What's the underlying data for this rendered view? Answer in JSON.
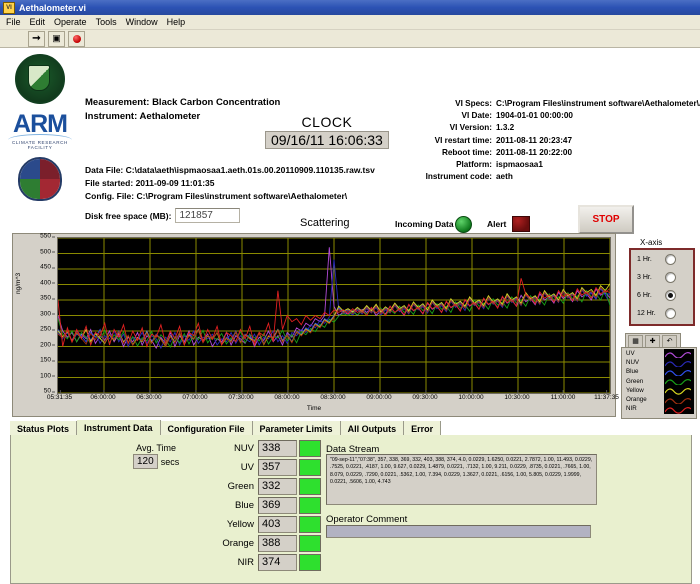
{
  "window": {
    "title": "Aethalometer.vi",
    "icon": "labview-icon"
  },
  "menu": [
    "File",
    "Edit",
    "Operate",
    "Tools",
    "Window",
    "Help"
  ],
  "toolbar": {
    "run_icon": "run-arrow-icon",
    "pause_icon": "pause-icon",
    "abort_icon": "abort-record-icon"
  },
  "logos": {
    "doe_seal": "doe-seal",
    "arm_word": "ARM",
    "arm_sub": "CLIMATE RESEARCH FACILITY",
    "shield": "arm-shield"
  },
  "header": {
    "measurement_label": "Measurement:",
    "measurement_value": "Black Carbon Concentration",
    "instrument_label": "Instrument:",
    "instrument_value": "Aethalometer",
    "clock_title": "CLOCK",
    "clock_value": "09/16/11 16:06:33",
    "data_file_label": "Data File:",
    "data_file_value": "C:\\data\\aeth\\ispmaosaa1.aeth.01s.00.20110909.110135.raw.tsv",
    "file_started_label": "File started:",
    "file_started_value": "2011-09-09 11:01:35",
    "config_file_label": "Config. File:",
    "config_file_value": "C:\\Program Files\\instrument software\\Aethalometer\\",
    "disk_label": "Disk free space (MB):",
    "disk_value": "121857"
  },
  "vi_specs": [
    {
      "key": "VI Specs:",
      "value": "C:\\Program Files\\instrument software\\Aethalometer\\Aethalometer"
    },
    {
      "key": "VI Date:",
      "value": "1904-01-01 00:00:00"
    },
    {
      "key": "VI Version:",
      "value": "1.3.2"
    },
    {
      "key": "VI restart time:",
      "value": "2011-08-11 20:23:47"
    },
    {
      "key": "Reboot time:",
      "value": "2011-08-11 20:22:00"
    },
    {
      "key": "Platform:",
      "value": "ispmaosaa1"
    },
    {
      "key": "Instrument code:",
      "value": "aeth"
    }
  ],
  "indicators": {
    "scattering_label": "Scattering",
    "incoming_data_label": "Incoming Data",
    "incoming_data_state": "on",
    "alert_label": "Alert",
    "alert_state": "off",
    "stop_label": "STOP"
  },
  "x_axis_selector": {
    "title": "X-axis",
    "options": [
      "1 Hr.",
      "3 Hr.",
      "6 Hr.",
      "12 Hr."
    ],
    "selected": "6 Hr."
  },
  "legend": {
    "tools": [
      "grid-icon",
      "cursor-icon",
      "undo-icon"
    ],
    "entries": [
      {
        "name": "UV",
        "color": "#b24bd8"
      },
      {
        "name": "NUV",
        "color": "#2a2ab8"
      },
      {
        "name": "Blue",
        "color": "#3050f0"
      },
      {
        "name": "Green",
        "color": "#18a018"
      },
      {
        "name": "Yellow",
        "color": "#d8d820"
      },
      {
        "name": "Orange",
        "color": "#a03010"
      },
      {
        "name": "NIR",
        "color": "#e02020"
      }
    ]
  },
  "chart_data": {
    "type": "line",
    "title": "Scattering",
    "xlabel": "Time",
    "ylabel": "ng/m^3",
    "ylim": [
      50,
      550
    ],
    "yticks": [
      50,
      100,
      150,
      200,
      250,
      300,
      350,
      400,
      450,
      500,
      550
    ],
    "xticks": [
      "05:31:35",
      "06:00:00",
      "06:30:00",
      "07:00:00",
      "07:30:00",
      "08:00:00",
      "08:30:00",
      "09:00:00",
      "09:30:00",
      "10:00:00",
      "10:30:00",
      "11:00:00",
      "11:37:35"
    ],
    "grid": true,
    "grid_color": "#8a8a00",
    "plot_bg": "#000000",
    "series": [
      {
        "name": "UV",
        "color": "#b24bd8",
        "values": [
          300,
          250,
          230,
          245,
          215,
          240,
          225,
          255,
          210,
          235,
          220,
          250,
          215,
          240,
          200,
          230,
          215,
          245,
          205,
          235,
          220,
          195,
          230,
          210,
          245,
          200,
          235,
          215,
          250,
          205,
          230,
          220,
          240,
          200,
          225,
          215,
          245,
          205,
          235,
          225,
          210,
          240,
          200,
          230,
          220,
          250,
          215,
          235,
          205,
          245,
          230,
          260,
          250,
          275,
          265,
          290,
          280,
          300,
          520,
          330,
          300,
          310,
          305,
          315,
          300,
          320,
          310,
          325,
          300,
          315,
          305,
          330,
          310,
          320,
          300,
          335,
          315,
          325,
          305,
          340,
          320,
          330,
          310,
          345,
          325,
          335,
          315,
          350,
          330,
          340,
          320,
          355,
          335,
          345,
          325,
          360,
          340,
          350,
          330,
          365,
          345,
          355,
          335,
          370,
          350,
          360,
          340,
          375,
          355,
          365,
          345,
          380,
          360,
          370,
          350,
          385,
          365,
          375,
          357
        ]
      },
      {
        "name": "NUV",
        "color": "#2a2ab8",
        "values": [
          245,
          225,
          250,
          215,
          240,
          230,
          255,
          220,
          245,
          210,
          235,
          225,
          250,
          215,
          240,
          200,
          230,
          220,
          245,
          210,
          235,
          225,
          195,
          230,
          215,
          245,
          205,
          235,
          220,
          250,
          210,
          230,
          225,
          240,
          205,
          225,
          215,
          245,
          210,
          235,
          225,
          215,
          240,
          205,
          230,
          225,
          250,
          215,
          235,
          210,
          245,
          235,
          255,
          245,
          270,
          260,
          285,
          275,
          295,
          480,
          320,
          305,
          312,
          302,
          318,
          305,
          322,
          308,
          326,
          302,
          318,
          308,
          332,
          312,
          322,
          305,
          336,
          318,
          328,
          308,
          342,
          322,
          332,
          312,
          346,
          326,
          336,
          316,
          352,
          332,
          342,
          322,
          356,
          336,
          346,
          326,
          362,
          342,
          352,
          332,
          366,
          346,
          356,
          336,
          372,
          352,
          362,
          342,
          376,
          356,
          366,
          346,
          382,
          362,
          372,
          352,
          386,
          366,
          338
        ]
      },
      {
        "name": "Blue",
        "color": "#3050f0",
        "values": [
          255,
          230,
          245,
          220,
          250,
          235,
          215,
          245,
          230,
          255,
          210,
          240,
          225,
          250,
          215,
          235,
          205,
          230,
          220,
          250,
          215,
          240,
          225,
          200,
          235,
          215,
          245,
          210,
          240,
          225,
          255,
          215,
          235,
          225,
          245,
          210,
          230,
          220,
          250,
          215,
          240,
          230,
          220,
          245,
          210,
          235,
          230,
          255,
          220,
          240,
          215,
          250,
          240,
          260,
          250,
          275,
          265,
          290,
          280,
          300,
          325,
          310,
          318,
          308,
          322,
          310,
          328,
          312,
          332,
          308,
          324,
          312,
          336,
          318,
          328,
          310,
          340,
          322,
          334,
          314,
          346,
          328,
          338,
          318,
          350,
          332,
          342,
          326,
          356,
          336,
          346,
          328,
          360,
          340,
          350,
          332,
          366,
          346,
          356,
          336,
          370,
          350,
          360,
          340,
          376,
          356,
          366,
          346,
          380,
          360,
          370,
          350,
          386,
          366,
          376,
          356,
          390,
          370,
          369
        ]
      },
      {
        "name": "Green",
        "color": "#18a018",
        "values": [
          290,
          240,
          225,
          250,
          215,
          245,
          230,
          210,
          240,
          225,
          252,
          212,
          238,
          222,
          248,
          212,
          232,
          202,
          228,
          218,
          248,
          212,
          238,
          222,
          198,
          232,
          212,
          242,
          208,
          238,
          222,
          252,
          212,
          232,
          222,
          242,
          208,
          228,
          218,
          248,
          212,
          238,
          228,
          218,
          242,
          208,
          232,
          228,
          252,
          218,
          238,
          212,
          248,
          238,
          258,
          248,
          272,
          262,
          288,
          278,
          298,
          306,
          300,
          312,
          302,
          316,
          305,
          320,
          308,
          324,
          302,
          318,
          306,
          330,
          310,
          320,
          304,
          334,
          316,
          326,
          306,
          338,
          320,
          330,
          310,
          344,
          324,
          334,
          314,
          350,
          330,
          340,
          320,
          354,
          334,
          344,
          324,
          360,
          340,
          350,
          330,
          364,
          344,
          354,
          334,
          370,
          350,
          360,
          340,
          374,
          354,
          364,
          344,
          380,
          360,
          370,
          350,
          384,
          332
        ]
      },
      {
        "name": "Yellow",
        "color": "#d8d820",
        "values": [
          250,
          232,
          248,
          218,
          244,
          228,
          254,
          216,
          242,
          226,
          210,
          238,
          220,
          246,
          214,
          234,
          206,
          228,
          216,
          246,
          212,
          236,
          224,
          202,
          234,
          214,
          244,
          206,
          236,
          224,
          254,
          214,
          234,
          224,
          244,
          206,
          226,
          216,
          246,
          214,
          236,
          226,
          216,
          244,
          206,
          234,
          226,
          254,
          216,
          236,
          214,
          246,
          236,
          256,
          246,
          272,
          262,
          286,
          276,
          296,
          330,
          314,
          322,
          312,
          326,
          314,
          332,
          316,
          336,
          312,
          328,
          316,
          340,
          322,
          332,
          314,
          344,
          326,
          338,
          318,
          350,
          332,
          342,
          322,
          354,
          336,
          346,
          330,
          360,
          340,
          350,
          332,
          364,
          344,
          354,
          336,
          370,
          350,
          360,
          340,
          374,
          354,
          364,
          344,
          380,
          360,
          370,
          350,
          384,
          364,
          374,
          354,
          390,
          374,
          384,
          364,
          396,
          380,
          403
        ]
      },
      {
        "name": "Orange",
        "color": "#a03010",
        "values": [
          240,
          228,
          252,
          214,
          246,
          226,
          208,
          242,
          222,
          250,
          212,
          240,
          222,
          248,
          210,
          236,
          204,
          226,
          218,
          244,
          210,
          238,
          222,
          200,
          232,
          212,
          246,
          208,
          234,
          226,
          252,
          212,
          236,
          222,
          246,
          208,
          228,
          214,
          248,
          212,
          238,
          224,
          214,
          246,
          208,
          236,
          224,
          252,
          214,
          238,
          212,
          248,
          234,
          254,
          244,
          270,
          260,
          284,
          274,
          294,
          320,
          308,
          316,
          306,
          320,
          308,
          326,
          310,
          330,
          306,
          322,
          310,
          334,
          316,
          326,
          308,
          338,
          320,
          332,
          312,
          344,
          326,
          336,
          316,
          348,
          330,
          340,
          324,
          354,
          334,
          344,
          326,
          358,
          338,
          348,
          330,
          364,
          344,
          354,
          334,
          368,
          348,
          358,
          338,
          374,
          354,
          364,
          344,
          378,
          358,
          368,
          348,
          384,
          368,
          378,
          358,
          390,
          374,
          388
        ]
      },
      {
        "name": "NIR",
        "color": "#e02020",
        "values": [
          350,
          200,
          260,
          215,
          255,
          225,
          265,
          205,
          245,
          235,
          275,
          205,
          255,
          230,
          270,
          210,
          250,
          220,
          260,
          200,
          240,
          230,
          270,
          210,
          250,
          225,
          265,
          205,
          245,
          235,
          275,
          215,
          255,
          225,
          265,
          205,
          245,
          235,
          215,
          255,
          225,
          265,
          205,
          245,
          235,
          275,
          215,
          380,
          255,
          300,
          280,
          290,
          270,
          300,
          285,
          300,
          290,
          310,
          300,
          318,
          310,
          318,
          306,
          322,
          310,
          316,
          300,
          326,
          308,
          320,
          300,
          330,
          310,
          322,
          302,
          336,
          316,
          326,
          306,
          342,
          322,
          332,
          310,
          346,
          326,
          336,
          314,
          352,
          332,
          342,
          320,
          356,
          336,
          346,
          324,
          362,
          342,
          352,
          330,
          420,
          368,
          358,
          338,
          376,
          356,
          366,
          344,
          380,
          360,
          370,
          348,
          386,
          366,
          376,
          356,
          390,
          370,
          380,
          374
        ]
      }
    ]
  },
  "tabs": [
    {
      "label": "Status Plots",
      "active": false
    },
    {
      "label": "Instrument Data",
      "active": true
    },
    {
      "label": "Configuration File",
      "active": false
    },
    {
      "label": "Parameter Limits",
      "active": false
    },
    {
      "label": "All Outputs",
      "active": false
    },
    {
      "label": "Error",
      "active": false
    }
  ],
  "instrument_data": {
    "avg_time_label": "Avg. Time",
    "avg_time_value": "120",
    "avg_time_unit": "secs",
    "readouts": [
      {
        "label": "NUV",
        "value": "338",
        "led": "#2ee02e"
      },
      {
        "label": "UV",
        "value": "357",
        "led": "#2ee02e"
      },
      {
        "label": "Green",
        "value": "332",
        "led": "#2ee02e"
      },
      {
        "label": "Blue",
        "value": "369",
        "led": "#2ee02e"
      },
      {
        "label": "Yellow",
        "value": "403",
        "led": "#2ee02e"
      },
      {
        "label": "Orange",
        "value": "388",
        "led": "#2ee02e"
      },
      {
        "label": "NIR",
        "value": "374",
        "led": "#2ee02e"
      }
    ],
    "data_stream_label": "Data Stream",
    "data_stream_value": "\"09-sep-11\",\"07:38\",  357,  338,  369,  332,  403,  388,  374, 4.0, 0.0229, 1.6250, 0.0221, 2.7872, 1.00, 11.493, 0.0229, .7525, 0.0221, .4187, 1.00, 9.627, 0.0229, 1.4879, 0.0221, .7132, 1.00, 9.211, 0.0229, .8735, 0.0221, .7665, 1.00, 8.079, 0.0229, .7290, 0.0221, .5362, 1.00, 7.394, 0.0229, 1.3627, 0.0221, .6156, 1.00, 5.805, 0.0229, 1.9999, 0.0221, .5606, 1.00, 4.743",
    "operator_comment_label": "Operator Comment",
    "operator_comment_value": ""
  }
}
